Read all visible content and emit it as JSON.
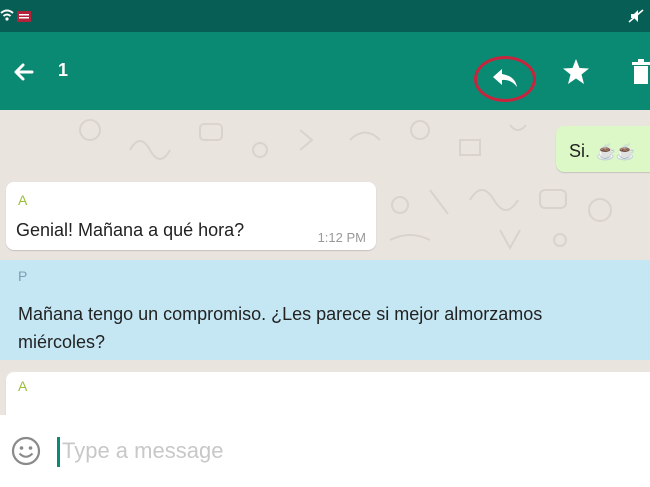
{
  "status_bar": {
    "left_icons": [
      "wifi-icon",
      "notification-icon"
    ],
    "right_icons": [
      "mute-icon"
    ]
  },
  "action_bar": {
    "selected_count": "1",
    "actions": [
      "back-arrow-icon",
      "reply-icon",
      "star-icon",
      "delete-icon"
    ],
    "highlight_color": "#c9243d",
    "bar_color": "#0b8a73"
  },
  "messages": [
    {
      "direction": "out",
      "text": "Si.",
      "emoji": "☕☕"
    },
    {
      "direction": "in",
      "sender": "A",
      "text": "Genial! Mañana a qué hora?",
      "time": "1:12 PM"
    },
    {
      "direction": "in",
      "sender": "P",
      "selected": true,
      "text_line1": "Mañana tengo un compromiso. ¿Les parece si mejor almorzamos",
      "text_line2": "miércoles?"
    },
    {
      "direction": "in",
      "sender": "A"
    }
  ],
  "composer": {
    "placeholder": "Type a message",
    "emoji_icon": "smiley-icon"
  }
}
